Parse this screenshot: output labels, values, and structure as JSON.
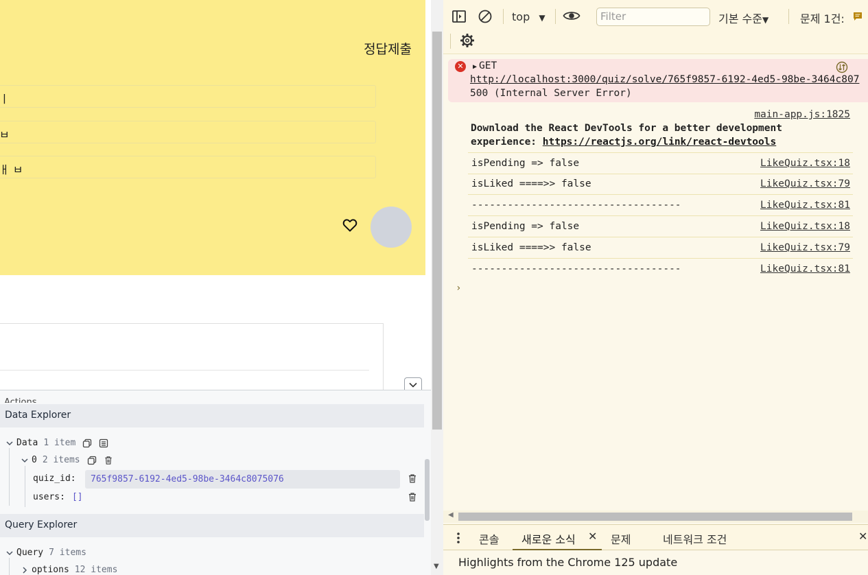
{
  "quiz": {
    "submit_label": "정답제출",
    "options": [
      "ㅣ",
      "ㅂ",
      "ㅐ ㅂ"
    ]
  },
  "query_devtools": {
    "actions_label": "Actions",
    "data_explorer": {
      "title": "Data Explorer",
      "data_label": "Data",
      "data_count": "1 item",
      "item_index": "0",
      "item_count": "2 items",
      "quiz_id_key": "quiz_id:",
      "quiz_id_value": "765f9857-6192-4ed5-98be-3464c8075076",
      "users_key": "users:",
      "users_value": "[]"
    },
    "query_explorer": {
      "title": "Query Explorer",
      "query_label": "Query",
      "query_count": "7 items",
      "options_label": "options",
      "options_count": "12 items"
    }
  },
  "devtools": {
    "context": "top",
    "filter_placeholder": "Filter",
    "level": "기본 수준",
    "issues": "문제 1건:",
    "error": {
      "method": "GET",
      "url": "http://localhost:3000/quiz/solve/765f9857-6192-4ed5-98be-3464c807",
      "status": "500 (Internal Server Error)"
    },
    "react_msg": {
      "source": "main-app.js:1825",
      "line1": "Download the React DevTools for a better development",
      "line2_prefix": "experience: ",
      "line2_link": "https://reactjs.org/link/react-devtools"
    },
    "logs": [
      {
        "text": "isPending => false",
        "source": "LikeQuiz.tsx:18"
      },
      {
        "text": "isLiked ====>> false",
        "source": "LikeQuiz.tsx:79"
      },
      {
        "text": "-----------------------------------",
        "source": "LikeQuiz.tsx:81"
      },
      {
        "text": "isPending => false",
        "source": "LikeQuiz.tsx:18"
      },
      {
        "text": "isLiked ====>> false",
        "source": "LikeQuiz.tsx:79"
      },
      {
        "text": "-----------------------------------",
        "source": "LikeQuiz.tsx:81"
      }
    ],
    "drawer_tabs": [
      "콘솔",
      "새로운 소식",
      "문제",
      "네트워크 조건"
    ],
    "drawer_message": "Highlights from the Chrome 125 update"
  }
}
